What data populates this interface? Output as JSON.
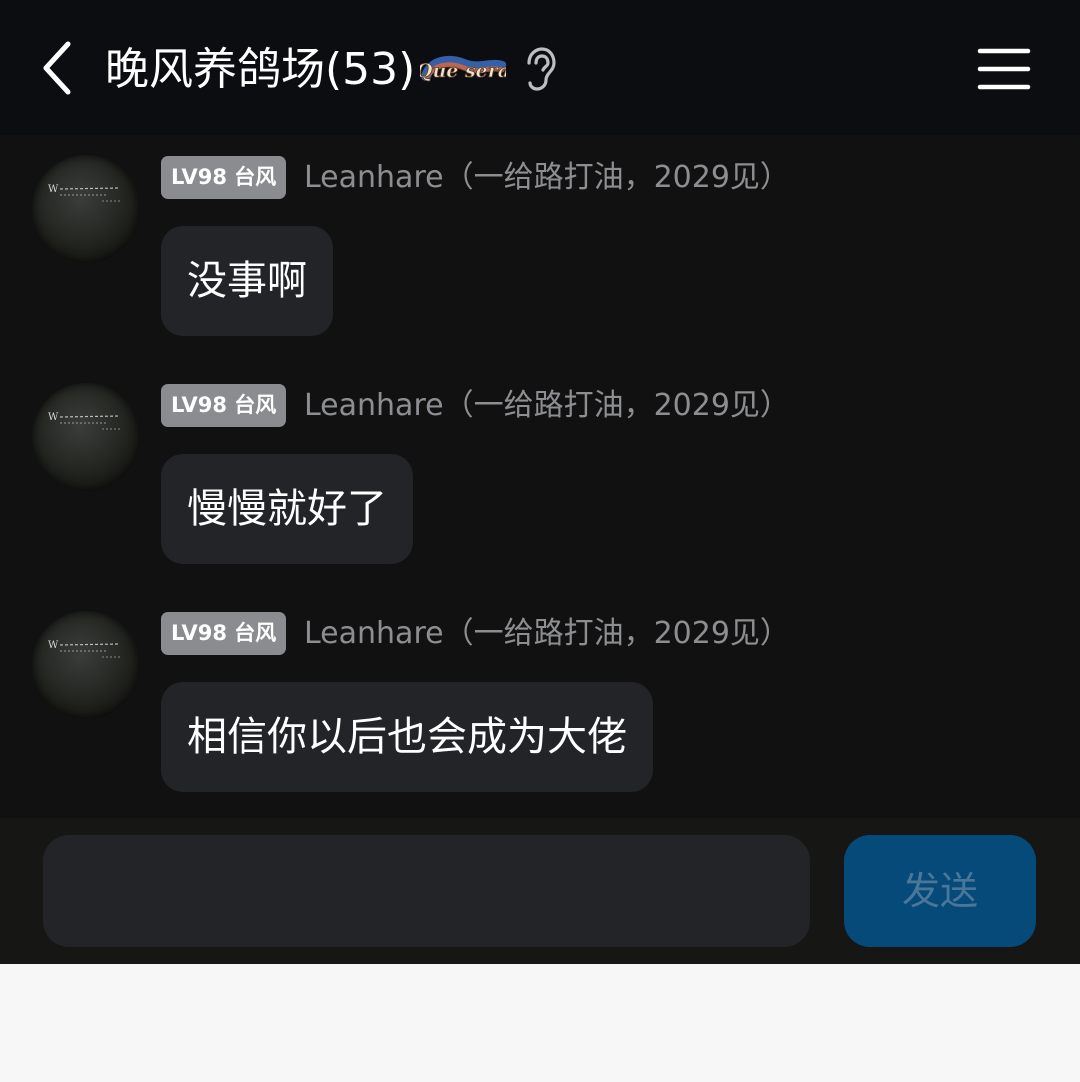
{
  "header": {
    "back_icon": "chevron-left-icon",
    "title": "晚风养鸽场(53)",
    "logo_text": "Que sera",
    "ear_icon": "ear-icon",
    "menu_icon": "hamburger-menu-icon"
  },
  "messages": [
    {
      "level": "LV98 台风",
      "sender": "Leanhare（一给路打油，2029见）",
      "text": "没事啊"
    },
    {
      "level": "LV98 台风",
      "sender": "Leanhare（一给路打油，2029见）",
      "text": "慢慢就好了"
    },
    {
      "level": "LV98 台风",
      "sender": "Leanhare（一给路打油，2029见）",
      "text": "相信你以后也会成为大佬"
    }
  ],
  "composer": {
    "input_value": "",
    "send_label": "发送"
  },
  "colors": {
    "background": "#111111",
    "header": "#0b0d11",
    "bubble": "#222428",
    "level_badge": "#8b8c8f",
    "send_button": "#064a7a",
    "send_text": "#4a7797"
  }
}
